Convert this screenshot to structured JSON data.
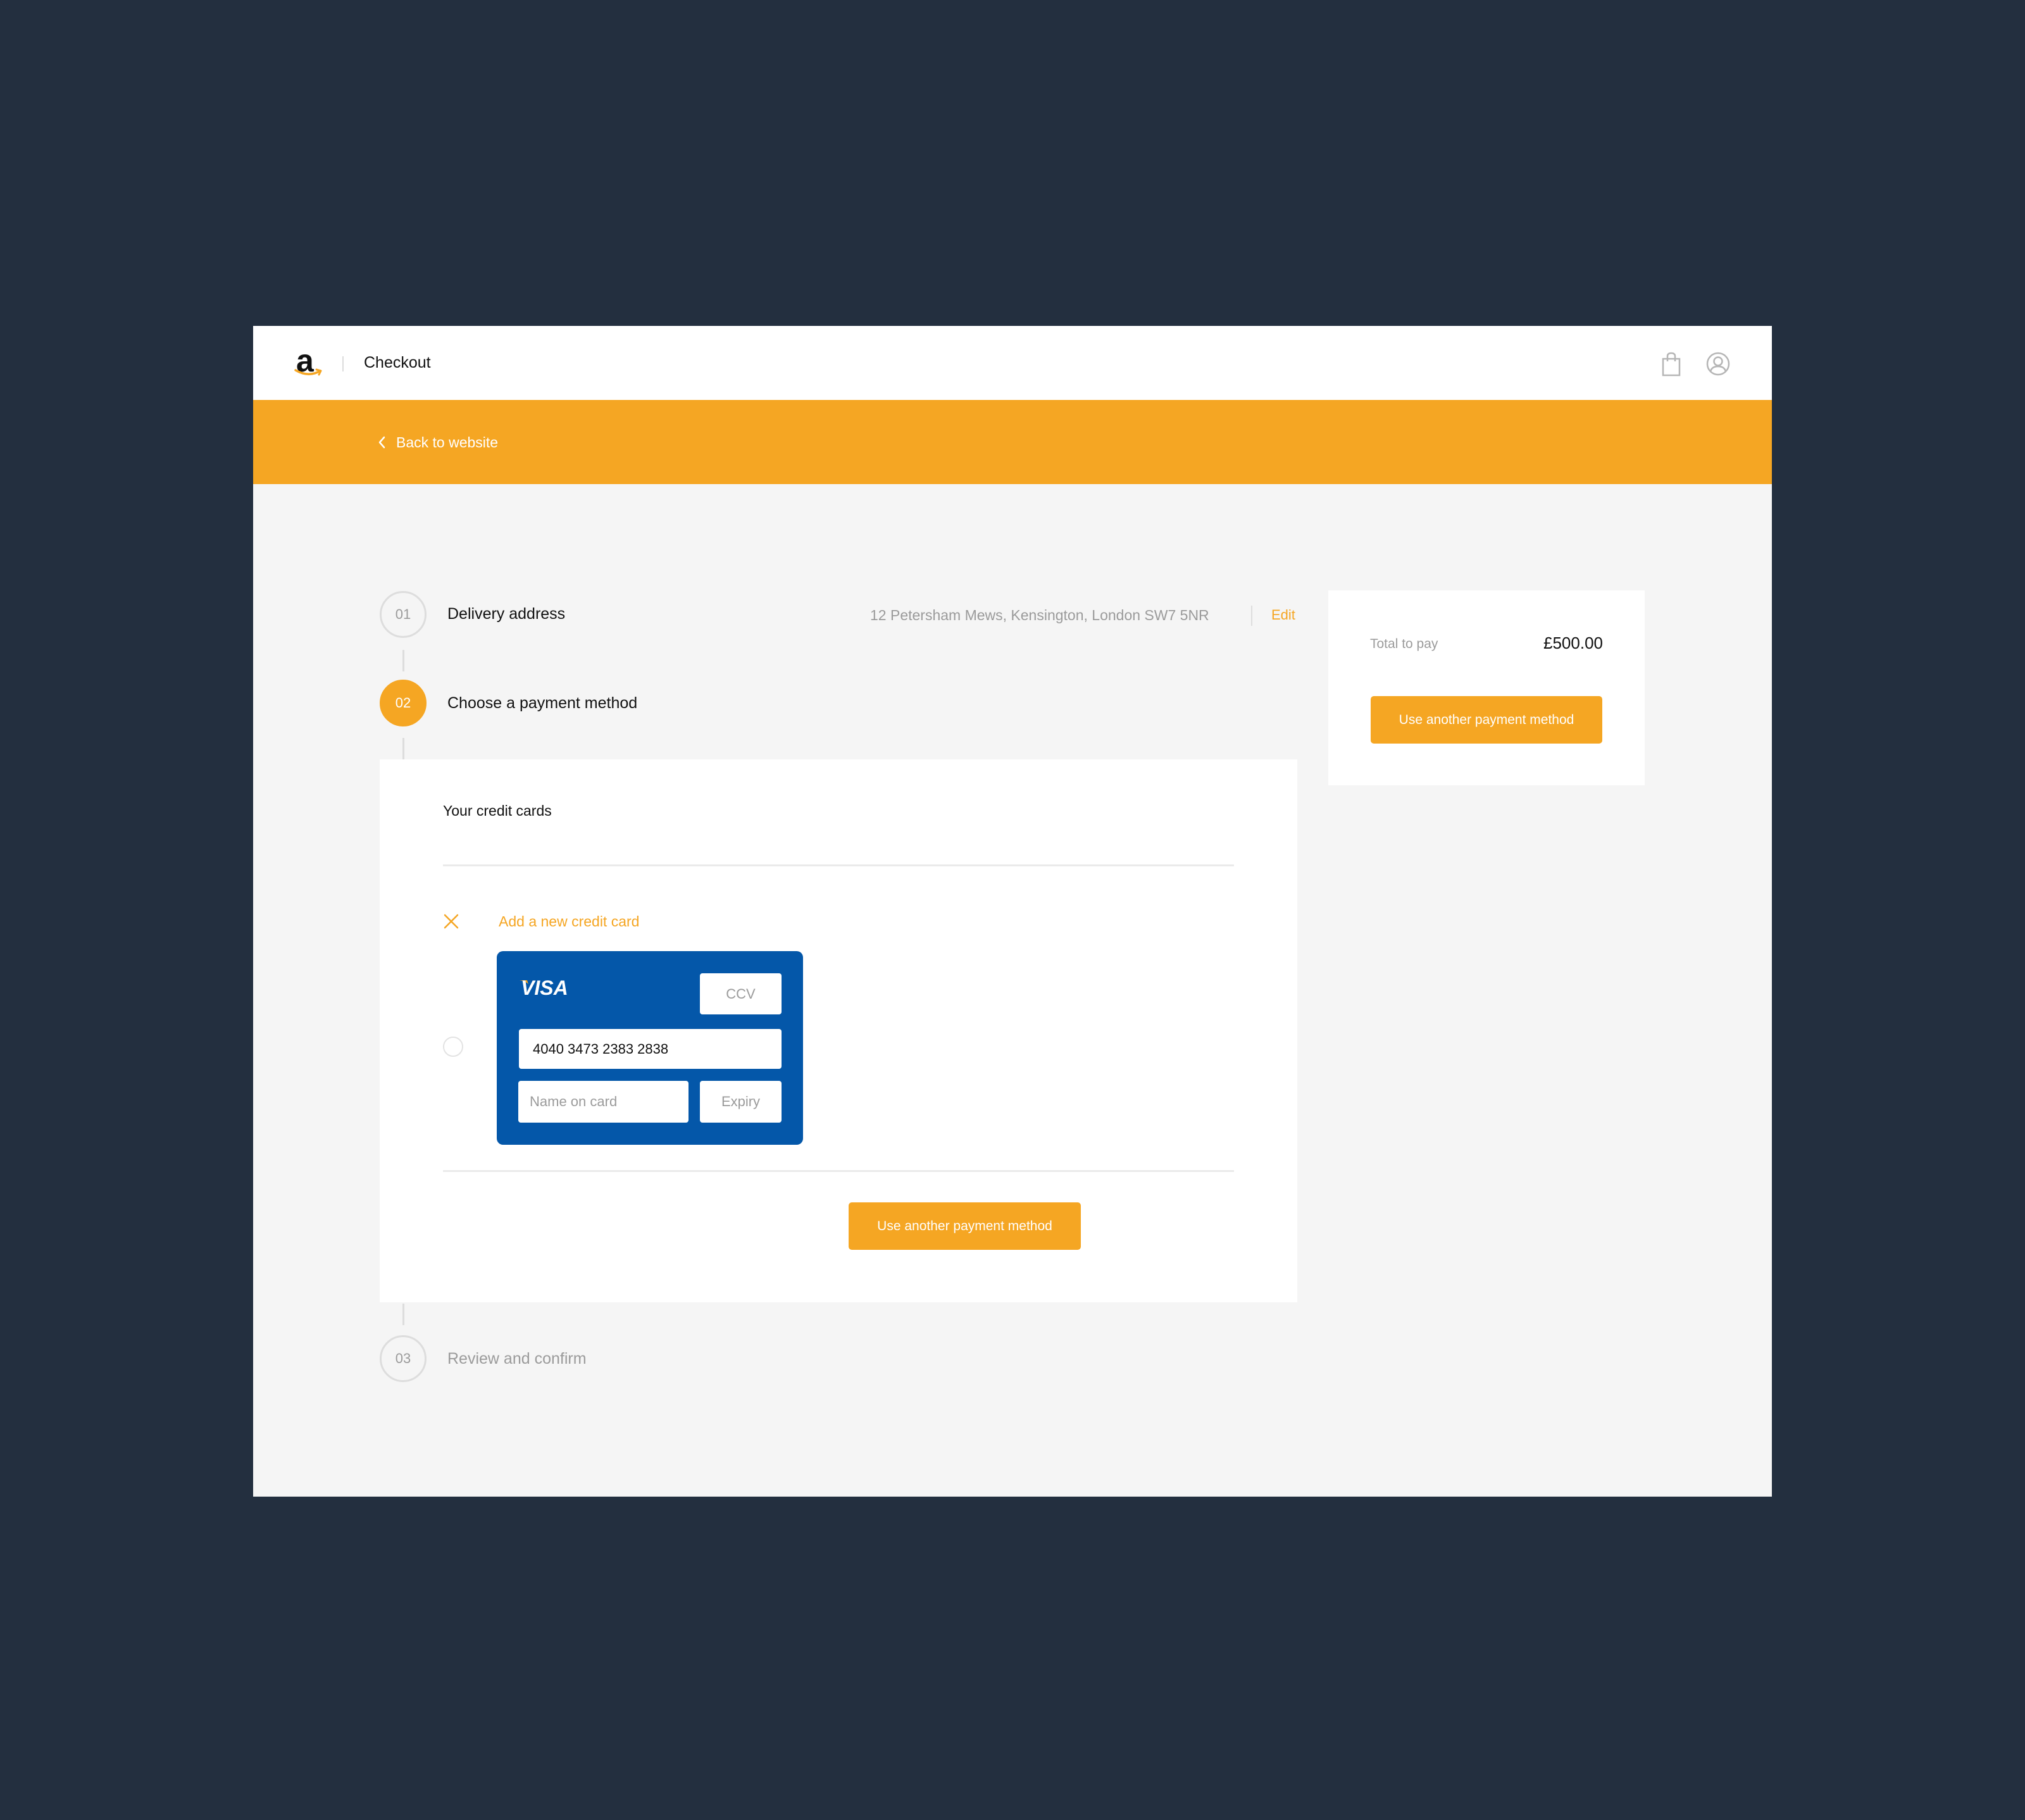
{
  "header": {
    "logo_letter": "a",
    "title": "Checkout",
    "icons": [
      "shopping-bag-icon",
      "user-account-icon"
    ]
  },
  "subheader": {
    "back_link": "Back to website"
  },
  "steps": [
    {
      "number": "01",
      "label": "Delivery address",
      "state": "completed",
      "address": "12 Petersham Mews, Kensington, London SW7 5NR",
      "edit_label": "Edit"
    },
    {
      "number": "02",
      "label": "Choose a payment method",
      "state": "active"
    },
    {
      "number": "03",
      "label": "Review and confirm",
      "state": "upcoming"
    }
  ],
  "payment": {
    "heading": "Your credit cards",
    "add_card_label": "Add a new credit card",
    "card": {
      "brand": "VISA",
      "ccv_placeholder": "CCV",
      "number_value": "4040 3473 2383 2838",
      "name_placeholder": "Name on card",
      "expiry_placeholder": "Expiry"
    },
    "button_label": "Use another payment method"
  },
  "summary": {
    "total_label": "Total to pay",
    "total_value": "£500.00",
    "button_label": "Use another payment method"
  },
  "colors": {
    "accent": "#f5a623",
    "card_blue": "#0457a9",
    "page_background": "#232f3f",
    "content_background": "#f5f5f5",
    "muted_text": "#9b9b9b"
  }
}
